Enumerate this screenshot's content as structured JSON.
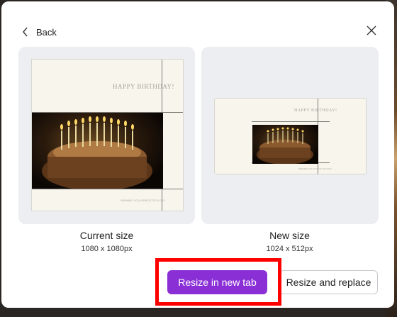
{
  "dialog": {
    "back_label": "Back",
    "current": {
      "title": "Current size",
      "dimensions": "1080 x 1080px"
    },
    "new": {
      "title": "New size",
      "dimensions": "1024 x 512px"
    },
    "preview_text": {
      "greeting": "HAPPY BIRTHDAY!",
      "footer": "WISHING YOU A PIECE OF A DAY"
    },
    "buttons": {
      "resize_new_tab": "Resize in new tab",
      "resize_replace": "Resize and replace"
    }
  },
  "colors": {
    "primary": "#8a2fd6",
    "highlight": "#ff0000",
    "card_bg": "#eceef2"
  },
  "icons": [
    "chevron-left-icon",
    "close-icon"
  ]
}
